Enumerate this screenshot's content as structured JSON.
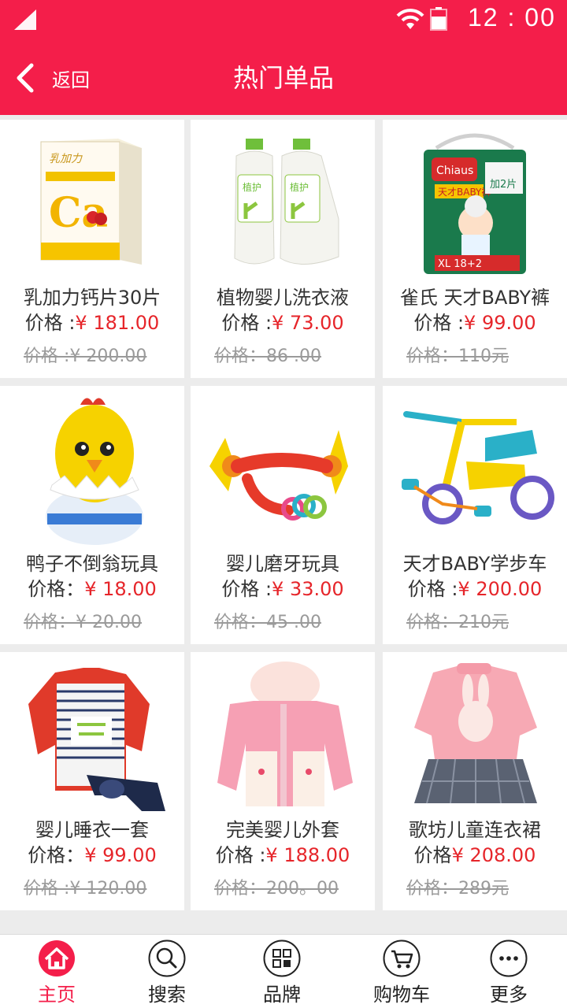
{
  "status": {
    "time": "12 : 00"
  },
  "header": {
    "back_label": "返回",
    "title": "热门单品"
  },
  "products": [
    {
      "name": "乳加力钙片30片",
      "price_label": "价格 :",
      "price": "¥ 181.00",
      "old_price": "价格 :¥ 200.00"
    },
    {
      "name": "植物婴儿洗衣液",
      "price_label": "价格 :",
      "price": "¥ 73.00",
      "old_price": "价格：86 .00"
    },
    {
      "name": "雀氏 天才BABY裤",
      "price_label": "价格 :",
      "price": "¥ 99.00",
      "old_price": "价格：110元"
    },
    {
      "name": "鸭子不倒翁玩具",
      "price_label": "价格：",
      "price": "¥ 18.00",
      "old_price": "价格：¥ 20.00"
    },
    {
      "name": "婴儿磨牙玩具",
      "price_label": "价格 :",
      "price": "¥ 33.00",
      "old_price": "价格：45 .00"
    },
    {
      "name": "天才BABY学步车",
      "price_label": "价格 :",
      "price": "¥ 200.00",
      "old_price": "价格：210元"
    },
    {
      "name": "婴儿睡衣一套",
      "price_label": "价格：",
      "price": "¥ 99.00",
      "old_price": "价格 :¥ 120.00"
    },
    {
      "name": "完美婴儿外套",
      "price_label": "价格 :",
      "price": "¥ 188.00",
      "old_price": "价格：200。00"
    },
    {
      "name": "歌坊儿童连衣裙",
      "price_label": "价格",
      "price": "¥ 208.00",
      "old_price": "价格：289元"
    }
  ],
  "tabs": [
    {
      "label": "主页",
      "icon": "home-icon"
    },
    {
      "label": "搜索",
      "icon": "search-icon"
    },
    {
      "label": "品牌",
      "icon": "brand-grid-icon"
    },
    {
      "label": "购物车",
      "icon": "cart-icon"
    },
    {
      "label": "更多",
      "icon": "more-icon"
    }
  ],
  "colors": {
    "primary": "#f41e4a",
    "price": "#e6252a"
  }
}
